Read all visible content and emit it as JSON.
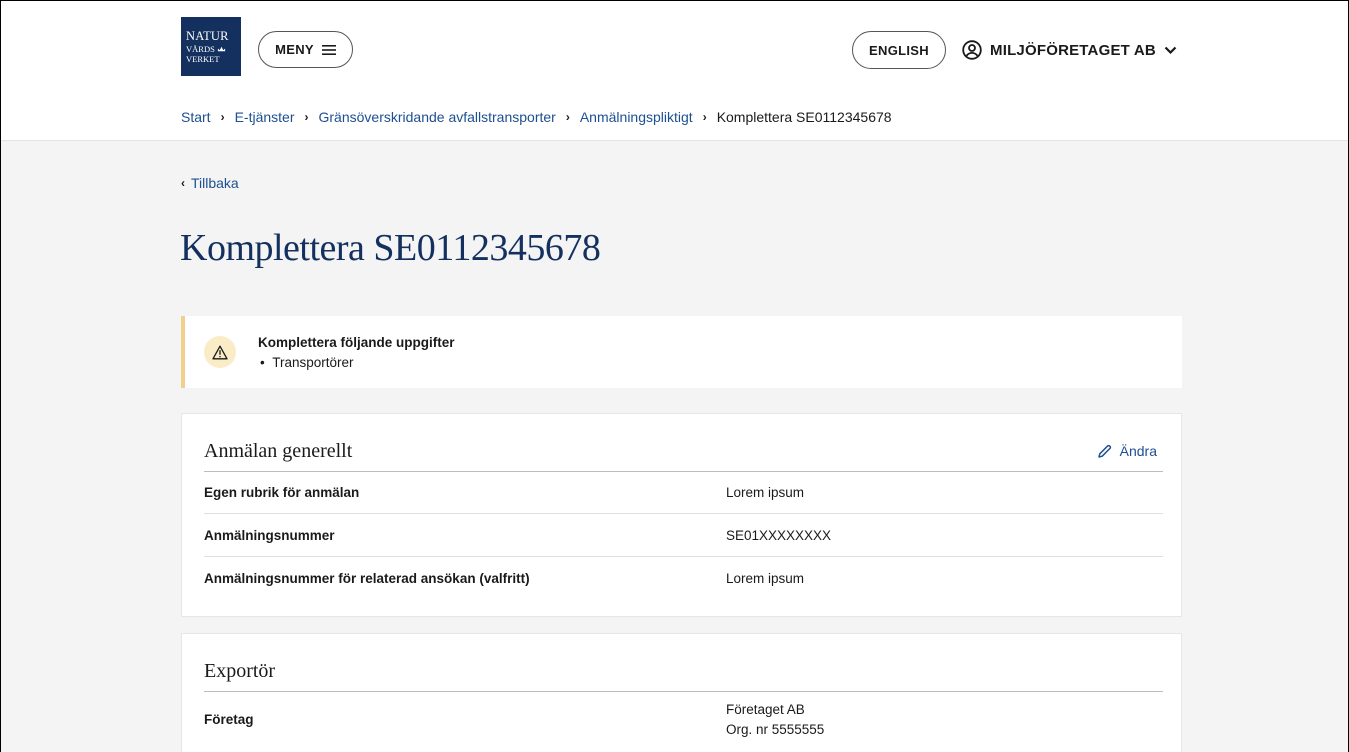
{
  "header": {
    "logo": {
      "line1": "NATUR",
      "line2": "VÅRDS",
      "line3": "VERKET"
    },
    "menu_label": "MENY",
    "menu_icon": "hamburger-icon",
    "language_label": "ENGLISH",
    "account_label": "MILJÖFÖRETAGET AB",
    "account_icon": "user-circle-icon"
  },
  "breadcrumb": {
    "items": [
      "Start",
      "E-tjänster",
      "Gränsöverskridande avfallstransporter",
      "Anmälningspliktigt"
    ],
    "current": "Komplettera SE0112345678"
  },
  "back_label": "Tillbaka",
  "page_title": "Komplettera SE0112345678",
  "alert": {
    "title": "Komplettera följande uppgifter",
    "items": [
      "Transportörer"
    ],
    "icon": "warning-icon",
    "accent": "#f2d08c"
  },
  "sections": {
    "general": {
      "title": "Anmälan generellt",
      "edit_label": "Ändra",
      "rows": [
        {
          "label": "Egen rubrik för anmälan",
          "value": "Lorem ipsum"
        },
        {
          "label": "Anmälningsnummer",
          "value": "SE01XXXXXXXX"
        },
        {
          "label": "Anmälningsnummer för relaterad ansökan (valfritt)",
          "value": "Lorem ipsum"
        }
      ]
    },
    "exporter": {
      "title": "Exportör",
      "rows": [
        {
          "label": "Företag",
          "value_line1": "Företaget AB",
          "value_line2": "Org. nr 5555555"
        }
      ]
    }
  },
  "colors": {
    "brand": "#13305f",
    "link": "#1d4f91",
    "background": "#f4f4f4"
  }
}
